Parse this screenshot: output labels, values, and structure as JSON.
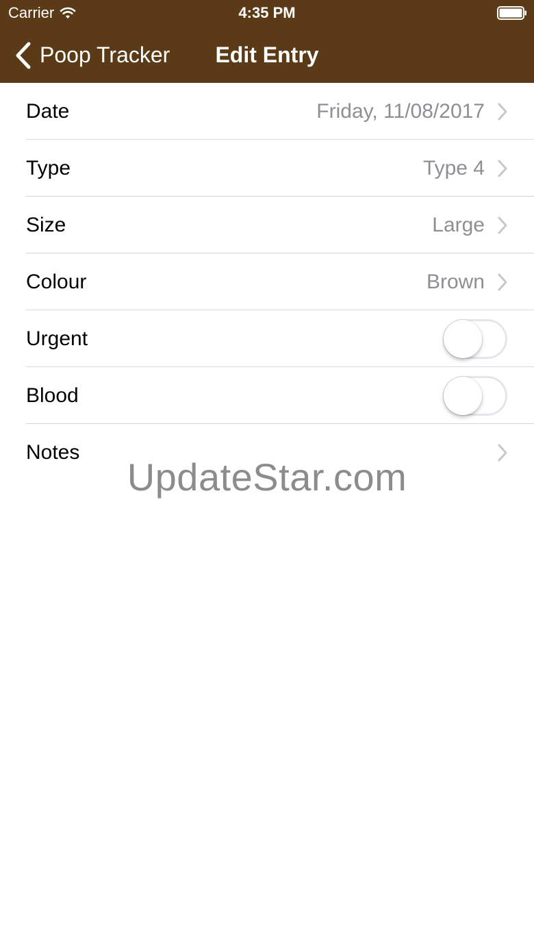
{
  "status_bar": {
    "carrier": "Carrier",
    "time": "4:35 PM",
    "wifi_icon": "wifi-icon",
    "battery_icon": "battery-icon"
  },
  "nav": {
    "back_label": "Poop Tracker",
    "back_icon": "chevron-left-icon",
    "title": "Edit Entry",
    "bar_color": "#5b3a17"
  },
  "rows": [
    {
      "label": "Date",
      "value": "Friday, 11/08/2017",
      "accessory": "chevron"
    },
    {
      "label": "Type",
      "value": "Type 4",
      "accessory": "chevron"
    },
    {
      "label": "Size",
      "value": "Large",
      "accessory": "chevron"
    },
    {
      "label": "Colour",
      "value": "Brown",
      "accessory": "chevron"
    },
    {
      "label": "Urgent",
      "accessory": "toggle",
      "on": false
    },
    {
      "label": "Blood",
      "accessory": "toggle",
      "on": false
    },
    {
      "label": "Notes",
      "value": "",
      "accessory": "chevron"
    }
  ],
  "watermark": "UpdateStar.com",
  "colors": {
    "value_text": "#8e8e93",
    "chevron": "#c7c7cc",
    "separator": "#d6d6d8"
  }
}
